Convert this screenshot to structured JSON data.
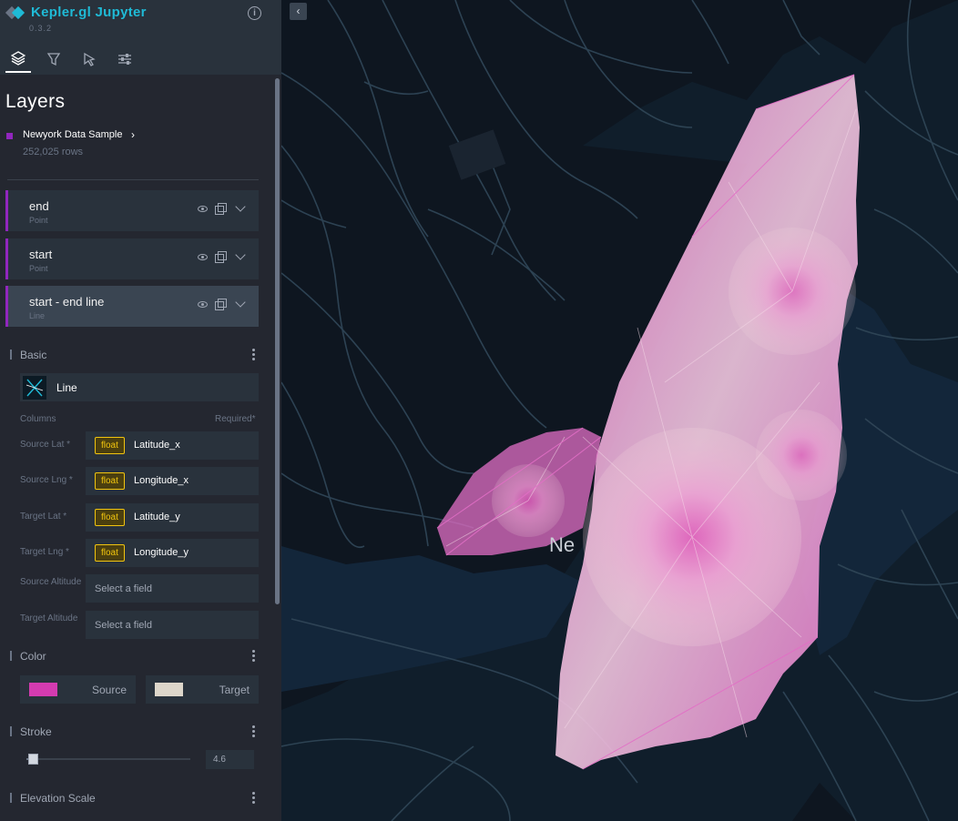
{
  "app": {
    "title": "Kepler.gl Jupyter",
    "version": "0.3.2"
  },
  "panel_tabs": [
    {
      "name": "layer",
      "icon": "layers-icon",
      "active": true
    },
    {
      "name": "filter",
      "icon": "filter-icon",
      "active": false
    },
    {
      "name": "interaction",
      "icon": "cursor-icon",
      "active": false
    },
    {
      "name": "map-style",
      "icon": "sliders-icon",
      "active": false
    }
  ],
  "layers_panel": {
    "title": "Layers",
    "dataset": {
      "name": "Newyork Data Sample",
      "rows": "252,025 rows",
      "color": "#9126be"
    },
    "layers": [
      {
        "name": "end",
        "type": "Point"
      },
      {
        "name": "start",
        "type": "Point"
      },
      {
        "name": "start - end line",
        "type": "Line"
      }
    ]
  },
  "layer_config": {
    "basic": {
      "label": "Basic",
      "layer_type": "Line",
      "columns_label": "Columns",
      "required_label": "Required*",
      "fields": [
        {
          "label": "Source Lat *",
          "type": "float",
          "value": "Latitude_x"
        },
        {
          "label": "Source Lng *",
          "type": "float",
          "value": "Longitude_x"
        },
        {
          "label": "Target Lat *",
          "type": "float",
          "value": "Latitude_y"
        },
        {
          "label": "Target Lng *",
          "type": "float",
          "value": "Longitude_y"
        }
      ],
      "optional_fields": [
        {
          "label": "Source Altitude",
          "placeholder": "Select a field"
        },
        {
          "label": "Target Altitude",
          "placeholder": "Select a field"
        }
      ]
    },
    "color": {
      "label": "Color",
      "source_label": "Source",
      "source_color": "#d43bb0",
      "target_label": "Target",
      "target_color": "#ddd6ca"
    },
    "stroke": {
      "label": "Stroke",
      "value": "4.6"
    },
    "elevation": {
      "label": "Elevation Scale"
    }
  },
  "map": {
    "city_label": "Ne"
  },
  "colors": {
    "accent": "#1fbad6",
    "sidebar_bg": "#242730",
    "layer_accent": "#9126be",
    "float_badge": "#f1c40f",
    "arc_pink": "#e26fc6",
    "arc_light": "#f2d5dc"
  }
}
